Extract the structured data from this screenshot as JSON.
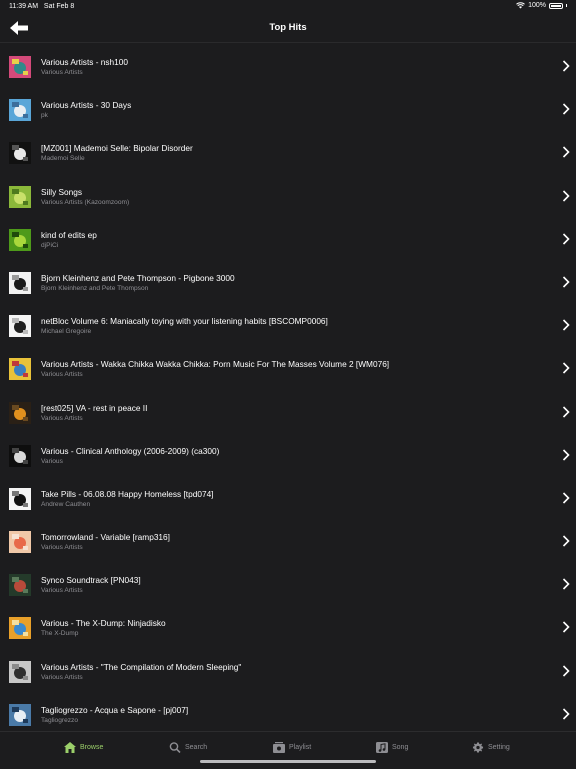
{
  "status": {
    "time": "11:39 AM",
    "date": "Sat Feb 8",
    "battery": "100%"
  },
  "nav": {
    "title": "Top Hits",
    "back_icon": "arrow-left-icon"
  },
  "items": [
    {
      "title": "Various Artists - nsh100",
      "subtitle": "Various Artists",
      "art": [
        "#d44a7a",
        "#2f8a8a",
        "#e6d04a"
      ]
    },
    {
      "title": "Various Artists - 30 Days",
      "subtitle": "pk",
      "art": [
        "#5aa6d8",
        "#e9eef2",
        "#3c6e9c"
      ]
    },
    {
      "title": "[MZ001] Mademoi Selle: Bipolar Disorder",
      "subtitle": "Mademoi Selle",
      "art": [
        "#111111",
        "#e8e8e8",
        "#555555"
      ]
    },
    {
      "title": "Silly Songs",
      "subtitle": "Various Artists (Kazoomzoom)",
      "art": [
        "#8bb83a",
        "#c9e06a",
        "#4e7a1e"
      ]
    },
    {
      "title": "kind of edits ep",
      "subtitle": "djPiCi",
      "art": [
        "#4e9a1a",
        "#a9d83c",
        "#1f4a0c"
      ]
    },
    {
      "title": "Bjorn Kleinhenz and Pete Thompson - Pigbone 3000",
      "subtitle": "Bjorn Kleinhenz and Pete Thompson",
      "art": [
        "#f2f2f2",
        "#1a1a1a",
        "#9a9a9a"
      ]
    },
    {
      "title": "netBloc Volume 6: Maniacally toying with your listening habits [BSCOMP0006]",
      "subtitle": "Michael Gregoire",
      "art": [
        "#f5f5f5",
        "#202020",
        "#bbbbbb"
      ]
    },
    {
      "title": "Various Artists - Wakka Chikka Wakka Chikka: Porn Music For The Masses Volume 2 [WM076]",
      "subtitle": "Various Artists",
      "art": [
        "#e8c23a",
        "#3a7fc0",
        "#c03a3a"
      ]
    },
    {
      "title": "[rest025] VA - rest in peace II",
      "subtitle": "Various Artists",
      "art": [
        "#2a2016",
        "#e0901e",
        "#6a4a20"
      ]
    },
    {
      "title": "Various - Clinical Anthology (2006-2009) (ca300)",
      "subtitle": "Various",
      "art": [
        "#0e0e0e",
        "#d8d8d8",
        "#444444"
      ]
    },
    {
      "title": "Take Pills - 06.08.08 Happy Homeless [tpd074]",
      "subtitle": "Andrew Cauthen",
      "art": [
        "#f4f4f4",
        "#111111",
        "#777777"
      ]
    },
    {
      "title": "Tomorrowland - Variable [ramp316]",
      "subtitle": "Various Artists",
      "art": [
        "#f0c8a8",
        "#e86a4a",
        "#f6e2d2"
      ]
    },
    {
      "title": "Synco Soundtrack [PN043]",
      "subtitle": "Various Artists",
      "art": [
        "#243a2a",
        "#b84a3a",
        "#5a7a5a"
      ]
    },
    {
      "title": "Various - The X-Dump: Ninjadisko",
      "subtitle": "The X-Dump",
      "art": [
        "#e8a02a",
        "#3a8ad0",
        "#f4e0a0"
      ]
    },
    {
      "title": "Various Artists - \"The Compilation of Modern Sleeping\"",
      "subtitle": "Various Artists",
      "art": [
        "#c8c8c8",
        "#303030",
        "#8a8a8a"
      ]
    },
    {
      "title": "Tagliogrezzo - Acqua e Sapone - [pj007]",
      "subtitle": "Tagliogrezzo",
      "art": [
        "#4a7aa8",
        "#e8eef4",
        "#1e3a5a"
      ]
    }
  ],
  "tabs": [
    {
      "label": "Browse",
      "icon": "home-icon",
      "active": true
    },
    {
      "label": "Search",
      "icon": "search-icon",
      "active": false
    },
    {
      "label": "Playlist",
      "icon": "playlist-icon",
      "active": false
    },
    {
      "label": "Song",
      "icon": "music-note-icon",
      "active": false
    },
    {
      "label": "Setting",
      "icon": "gear-icon",
      "active": false
    }
  ],
  "colors": {
    "background": "#1c1c1e",
    "accent": "#9bcf6a",
    "secondary_text": "#8e8e93"
  }
}
